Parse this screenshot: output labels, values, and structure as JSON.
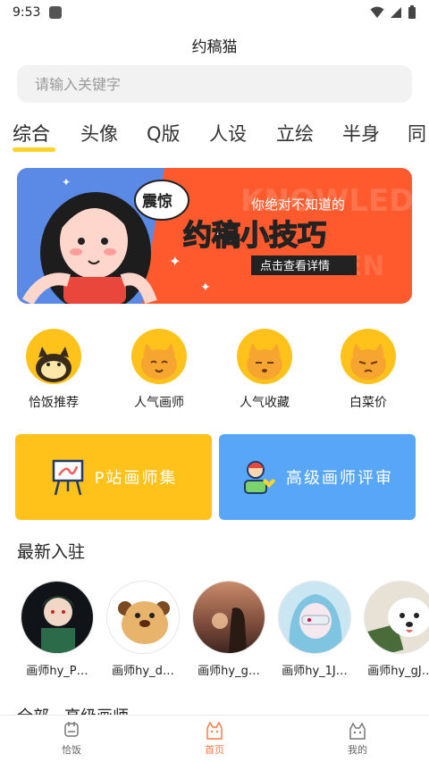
{
  "status_bar": {
    "time": "9:53"
  },
  "app": {
    "title": "约稿猫"
  },
  "search": {
    "placeholder": "请输入关键字"
  },
  "tabs": [
    {
      "label": "综合",
      "active": true
    },
    {
      "label": "头像"
    },
    {
      "label": "Q版"
    },
    {
      "label": "人设"
    },
    {
      "label": "立绘"
    },
    {
      "label": "半身"
    },
    {
      "label": "同"
    }
  ],
  "banner": {
    "tag": "震惊",
    "subtitle": "你绝对不知道的",
    "title": "约稿小技巧",
    "button": "点击查看详情",
    "bg_words": "KNOWLEDGE",
    "colors": {
      "left": "#5b8ae6",
      "right": "#ff5a2e"
    }
  },
  "quick_links": [
    {
      "label": "恰饭推荐",
      "icon": "cat-eating-icon"
    },
    {
      "label": "人气画师",
      "icon": "cat-happy-icon"
    },
    {
      "label": "人气收藏",
      "icon": "cat-sleepy-icon"
    },
    {
      "label": "白菜价",
      "icon": "cat-grumpy-icon"
    }
  ],
  "cards": [
    {
      "label": "P站画师集",
      "icon": "easel-icon",
      "color": "#ffc21a"
    },
    {
      "label": "高级画师评审",
      "icon": "reviewer-icon",
      "color": "#58a6f7"
    }
  ],
  "latest": {
    "title": "最新入驻",
    "artists": [
      {
        "name": "画师hy_P…"
      },
      {
        "name": "画师hy_d…"
      },
      {
        "name": "画师hy_g…"
      },
      {
        "name": "画师hy_1J…"
      },
      {
        "name": "画师hy_gJ…"
      }
    ]
  },
  "next_section_title": "全部 · 高级画师",
  "bottom_nav": [
    {
      "label": "恰饭",
      "icon": "bowl-icon"
    },
    {
      "label": "首页",
      "icon": "home-cat-icon",
      "active": true
    },
    {
      "label": "我的",
      "icon": "profile-cat-icon"
    }
  ]
}
